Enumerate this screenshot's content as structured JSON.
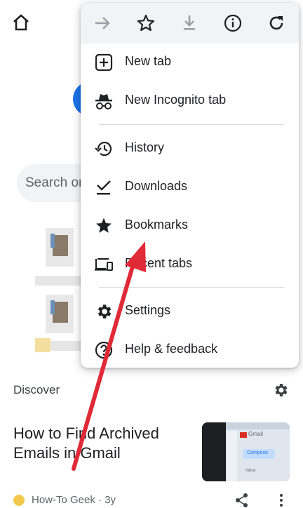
{
  "background": {
    "search_placeholder": "Search or",
    "discover_label": "Discover",
    "article": {
      "title": "How to Find Archived Emails in Gmail",
      "source": "How-To Geek",
      "age": " · 3y"
    },
    "thumbnail_text": {
      "brand": "Gmail",
      "compose": "Compose",
      "inbox": "Inbox"
    }
  },
  "menu": {
    "toolbar": [
      {
        "name": "forward-button",
        "icon": "arrow-right-icon"
      },
      {
        "name": "bookmark-star-button",
        "icon": "star-outline-icon"
      },
      {
        "name": "download-page-button",
        "icon": "download-icon"
      },
      {
        "name": "page-info-button",
        "icon": "info-icon"
      },
      {
        "name": "reload-button",
        "icon": "refresh-icon"
      }
    ],
    "items": [
      {
        "label": "New tab",
        "icon": "plus-box-icon"
      },
      {
        "label": "New Incognito tab",
        "icon": "incognito-icon"
      },
      {
        "label": "History",
        "icon": "history-icon"
      },
      {
        "label": "Downloads",
        "icon": "download-check-icon"
      },
      {
        "label": "Bookmarks",
        "icon": "star-filled-icon"
      },
      {
        "label": "Recent tabs",
        "icon": "devices-icon"
      },
      {
        "label": "Settings",
        "icon": "gear-icon"
      },
      {
        "label": "Help & feedback",
        "icon": "help-icon"
      }
    ]
  },
  "colors": {
    "annotation_arrow": "#e02a37",
    "accent_blue": "#1a73e8",
    "toolbar_bg": "#f1f3f4"
  }
}
